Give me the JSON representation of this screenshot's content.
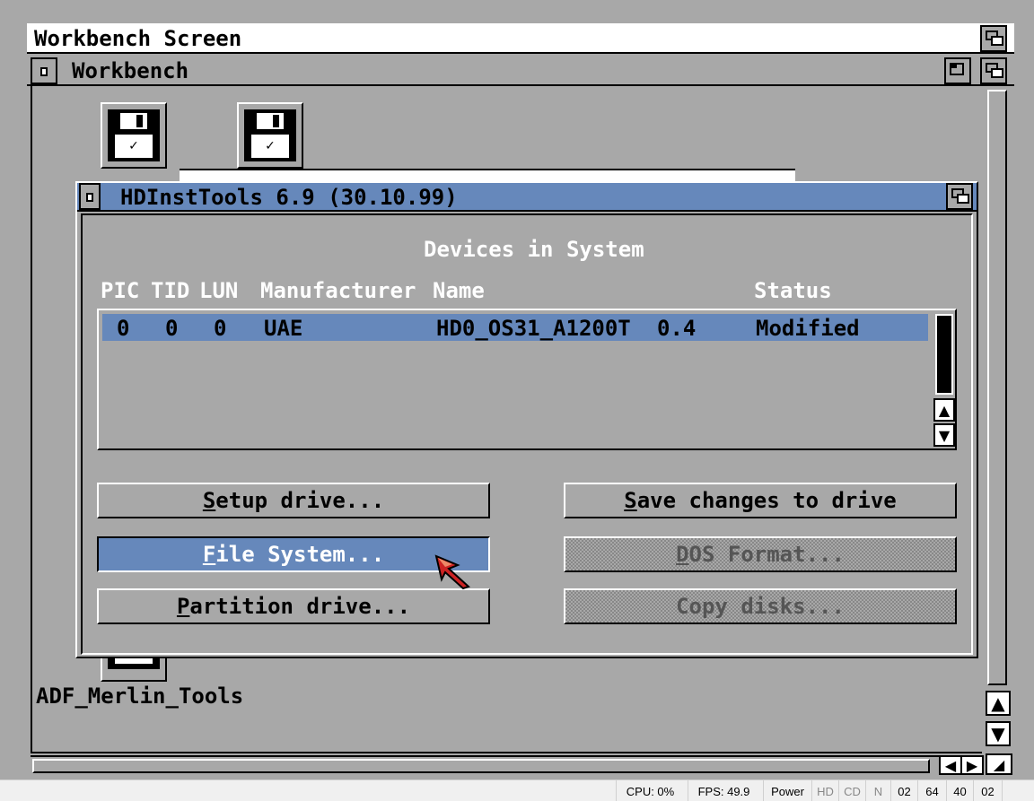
{
  "screen": {
    "title": "Workbench Screen"
  },
  "workbench": {
    "title": "Workbench"
  },
  "icons": [
    {
      "label": "ADF_Merlin_Tools"
    }
  ],
  "dialog": {
    "title": "HDInstTools 6.9 (30.10.99)",
    "heading": "Devices in System",
    "columns": {
      "pic": "PIC",
      "tid": "TID",
      "lun": "LUN",
      "manufacturer": "Manufacturer",
      "name": "Name",
      "status": "Status"
    },
    "devices": [
      {
        "pic": "0",
        "tid": "0",
        "lun": "0",
        "manufacturer": "UAE",
        "name": "HD0_OS31_A1200T",
        "rev": "0.4",
        "status": "Modified"
      }
    ],
    "buttons": {
      "setup": {
        "hot": "S",
        "rest": "etup drive..."
      },
      "save": {
        "hot": "S",
        "rest": "ave changes to drive"
      },
      "filesystem": {
        "hot": "F",
        "rest": "ile System..."
      },
      "dosformat": {
        "hot": "D",
        "rest": "OS Format..."
      },
      "partition": {
        "hot": "P",
        "rest": "artition drive..."
      },
      "copydisks": {
        "hot": "",
        "rest": "Copy disks..."
      }
    }
  },
  "statusbar": {
    "cpu": "CPU: 0%",
    "fps": "FPS: 49.9",
    "power": "Power",
    "hd": "HD",
    "cd": "CD",
    "n": "N",
    "df0": "02",
    "df1": "64",
    "df2": "40",
    "df3": "02"
  },
  "colors": {
    "background": "#a8a8a8",
    "accent": "#6688bb",
    "white": "#ffffff",
    "black": "#000000"
  }
}
